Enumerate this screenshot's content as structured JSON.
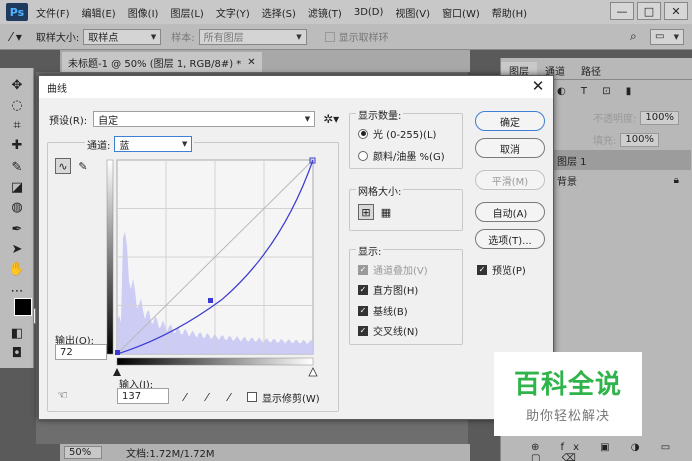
{
  "app": {
    "logo": "Ps",
    "menu": [
      "文件(F)",
      "编辑(E)",
      "图像(I)",
      "图层(L)",
      "文字(Y)",
      "选择(S)",
      "滤镜(T)",
      "3D(D)",
      "视图(V)",
      "窗口(W)",
      "帮助(H)"
    ],
    "window_buttons": [
      "—",
      "□",
      "✕"
    ]
  },
  "options_bar": {
    "sample_size_label": "取样大小:",
    "sample_size_value": "取样点",
    "sample_label": "样本:",
    "sample_value": "所有图层",
    "show_ring_label": "显示取样环"
  },
  "document": {
    "tab_title": "未标题-1 @ 50% (图层 1, RGB/8#) *",
    "zoom": "50%",
    "doc_size": "文档:1.72M/1.72M"
  },
  "right_panel": {
    "tabs": [
      "图层",
      "通道",
      "路径"
    ],
    "opacity_label": "不透明度:",
    "opacity_value": "100%",
    "fill_label": "填充:",
    "fill_value": "100%",
    "layers": [
      "图层 1",
      "背景"
    ]
  },
  "curves_dialog": {
    "title": "曲线",
    "preset_label": "预设(R):",
    "preset_value": "自定",
    "channel_label": "通道:",
    "channel_value": "蓝",
    "output_label": "输出(O):",
    "output_value": "72",
    "input_label": "输入(I):",
    "input_value": "137",
    "show_clipping_label": "显示修剪(W)",
    "show_amount_title": "显示数量:",
    "light_option": "光 (0-255)(L)",
    "pigment_option": "颜料/油墨 %(G)",
    "grid_size_title": "网格大小:",
    "show_title": "显示:",
    "show_options": [
      {
        "label": "通道叠加(V)",
        "checked": true,
        "disabled": true
      },
      {
        "label": "直方图(H)",
        "checked": true,
        "disabled": false
      },
      {
        "label": "基线(B)",
        "checked": true,
        "disabled": false
      },
      {
        "label": "交叉线(N)",
        "checked": true,
        "disabled": false
      }
    ],
    "buttons": {
      "ok": "确定",
      "cancel": "取消",
      "smooth": "平滑(M)",
      "auto": "自动(A)",
      "options": "选项(T)..."
    },
    "preview_label": "预览(P)",
    "curve_color": "#3a3ad0",
    "histogram_color": "#c8c8f4"
  },
  "watermark": {
    "main": "百科全说",
    "sub": "助你轻松解决"
  }
}
